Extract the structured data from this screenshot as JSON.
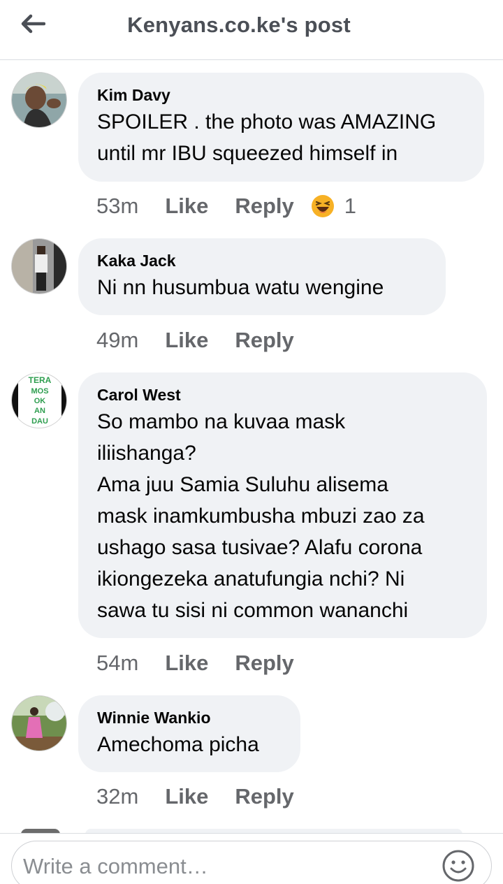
{
  "header": {
    "title": "Kenyans.co.ke's post"
  },
  "comments": [
    {
      "author": "Kim Davy",
      "text": "SPOILER . the photo was AMAZING\nuntil mr IBU squeezed himself in",
      "time": "53m",
      "like": "Like",
      "reply": "Reply",
      "reaction_count": "1",
      "reaction_icon": "laughing-emoji-icon"
    },
    {
      "author": "Kaka Jack",
      "text": "Ni nn husumbua watu wengine",
      "time": "49m",
      "like": "Like",
      "reply": "Reply"
    },
    {
      "author": "Carol West",
      "text": "So mambo na kuvaa mask\niliishanga?\nAma juu Samia Suluhu alisema\nmask inamkumbusha mbuzi zao za\nushago sasa tusivae? Alafu corona\nikiongezeka anatufungia nchi? Ni\nsawa tu sisi ni common wananchi",
      "time": "54m",
      "like": "Like",
      "reply": "Reply",
      "avatar_text": [
        "TERA",
        "MOS",
        "OK",
        "AN",
        "DAU"
      ],
      "avatar_text_color": "#2e9e4f"
    },
    {
      "author": "Winnie Wankio",
      "text": "Amechoma picha",
      "time": "32m",
      "like": "Like",
      "reply": "Reply"
    }
  ],
  "composer": {
    "placeholder": "Write a comment…",
    "emoji_icon": "smiley-icon"
  },
  "colors": {
    "bubble": "#f0f2f5",
    "meta_text": "#65676b",
    "header_text": "#4b4f56",
    "reaction": "#f7b125"
  }
}
